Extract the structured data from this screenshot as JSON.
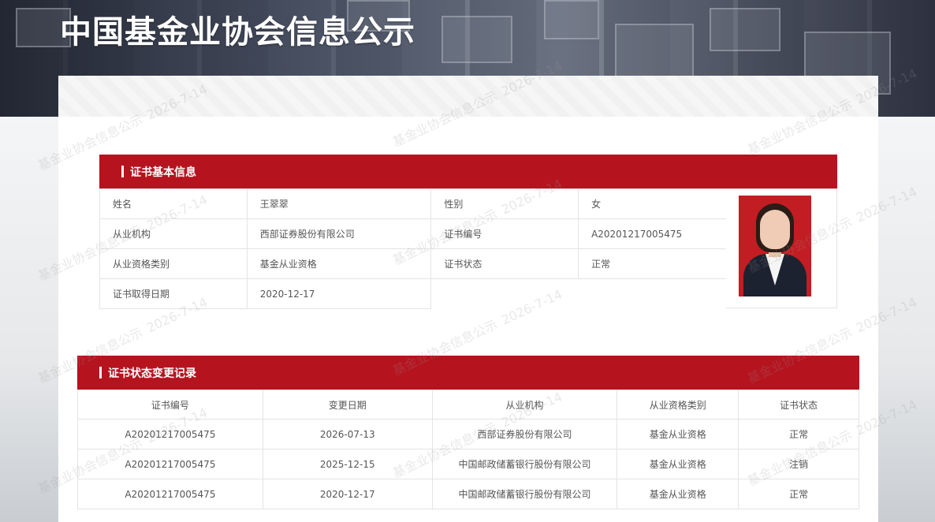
{
  "header": {
    "title": "中国基金业协会信息公示"
  },
  "basic_info": {
    "section_title": "证书基本信息",
    "rows": [
      {
        "label1": "姓名",
        "value1": "王翠翠",
        "label2": "性别",
        "value2": "女"
      },
      {
        "label1": "从业机构",
        "value1": "西部证券股份有限公司",
        "label2": "证书编号",
        "value2": "A20201217005475"
      },
      {
        "label1": "从业资格类别",
        "value1": "基金从业资格",
        "label2": "证书状态",
        "value2": "正常"
      },
      {
        "label1": "证书取得日期",
        "value1": "2020-12-17"
      }
    ]
  },
  "status_history": {
    "section_title": "证书状态变更记录",
    "columns": [
      "证书编号",
      "变更日期",
      "从业机构",
      "从业资格类别",
      "证书状态"
    ],
    "rows": [
      [
        "A20201217005475",
        "2026-07-13",
        "西部证券股份有限公司",
        "基金从业资格",
        "正常"
      ],
      [
        "A20201217005475",
        "2025-12-15",
        "中国邮政储蓄银行股份有限公司",
        "基金从业资格",
        "注销"
      ],
      [
        "A20201217005475",
        "2020-12-17",
        "中国邮政储蓄银行股份有限公司",
        "基金从业资格",
        "正常"
      ]
    ]
  },
  "watermark": {
    "text": "基金业协会信息公示",
    "date": "2026-7-14"
  }
}
